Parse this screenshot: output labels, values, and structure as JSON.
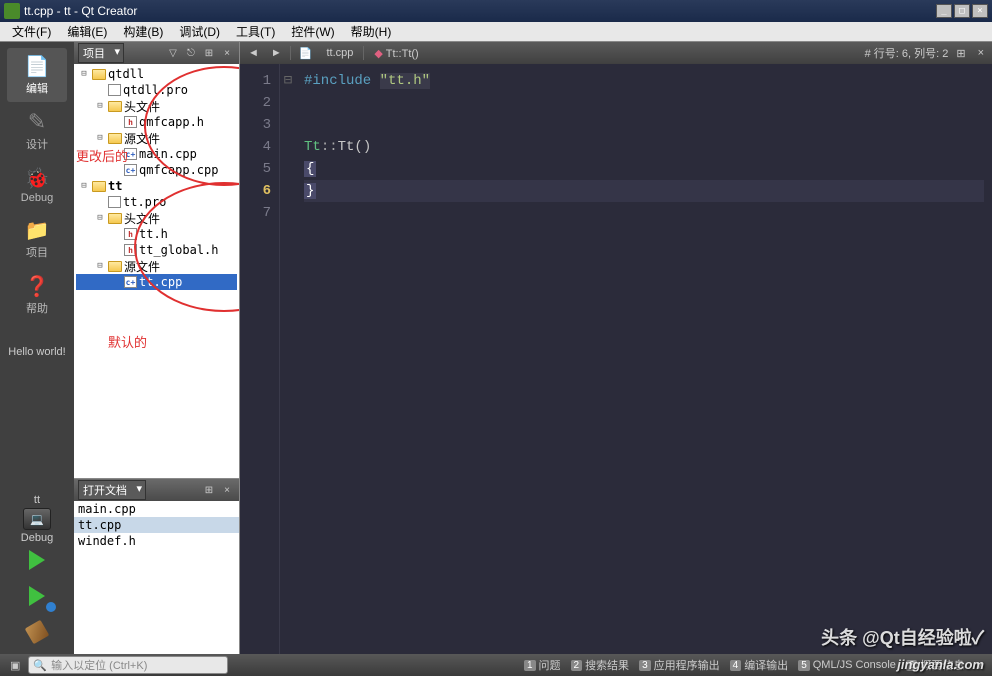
{
  "title": "tt.cpp - tt - Qt Creator",
  "menus": [
    "文件(F)",
    "编辑(E)",
    "构建(B)",
    "调试(D)",
    "工具(T)",
    "控件(W)",
    "帮助(H)"
  ],
  "mode_buttons": [
    {
      "icon": "edit",
      "label": "编辑",
      "sel": true
    },
    {
      "icon": "design",
      "label": "设计",
      "sel": false
    },
    {
      "icon": "debug",
      "label": "Debug",
      "sel": false
    },
    {
      "icon": "proj",
      "label": "项目",
      "sel": false
    },
    {
      "icon": "help",
      "label": "帮助",
      "sel": false
    }
  ],
  "hello": "Hello world!",
  "target_name": "tt",
  "target_config": "Debug",
  "project_panel": {
    "title": "项目"
  },
  "tree": [
    {
      "d": 0,
      "tw": "⊟",
      "ic": "folder",
      "t": "qtdll"
    },
    {
      "d": 1,
      "tw": "",
      "ic": "file-p",
      "t": "qtdll.pro"
    },
    {
      "d": 1,
      "tw": "⊟",
      "ic": "folder",
      "t": "头文件"
    },
    {
      "d": 2,
      "tw": "",
      "ic": "file-h",
      "t": "qmfcapp.h"
    },
    {
      "d": 1,
      "tw": "⊟",
      "ic": "folder",
      "t": "源文件"
    },
    {
      "d": 2,
      "tw": "",
      "ic": "file-c",
      "t": "main.cpp"
    },
    {
      "d": 2,
      "tw": "",
      "ic": "file-c",
      "t": "qmfcapp.cpp"
    },
    {
      "d": 0,
      "tw": "⊟",
      "ic": "folder",
      "t": "tt",
      "bold": true
    },
    {
      "d": 1,
      "tw": "",
      "ic": "file-p",
      "t": "tt.pro"
    },
    {
      "d": 1,
      "tw": "⊟",
      "ic": "folder",
      "t": "头文件"
    },
    {
      "d": 2,
      "tw": "",
      "ic": "file-h",
      "t": "tt.h"
    },
    {
      "d": 2,
      "tw": "",
      "ic": "file-h",
      "t": "tt_global.h"
    },
    {
      "d": 1,
      "tw": "⊟",
      "ic": "folder",
      "t": "源文件"
    },
    {
      "d": 2,
      "tw": "",
      "ic": "file-c",
      "t": "tt.cpp",
      "sel": true
    }
  ],
  "annotations": {
    "changed": "更改后的",
    "default": "默认的"
  },
  "open_docs": {
    "title": "打开文档",
    "items": [
      "main.cpp",
      "tt.cpp",
      "windef.h"
    ],
    "sel": 1
  },
  "editor_crumbs": {
    "file": "tt.cpp",
    "symbol": "Tt::Tt()"
  },
  "editor_status": "# 行号: 6, 列号: 2",
  "code_lines": [
    {
      "n": 1,
      "html": "<span class='pp'>#include</span> <span class='str'>\"tt.h\"</span>"
    },
    {
      "n": 2,
      "html": ""
    },
    {
      "n": 3,
      "html": ""
    },
    {
      "n": 4,
      "html": "<span class='cls'>Tt</span><span class='op'>::</span>Tt()",
      "fold": "⊟"
    },
    {
      "n": 5,
      "html": "<span class='brace'>{</span>"
    },
    {
      "n": 6,
      "html": "<span class='brace'>}</span>",
      "cur": true
    },
    {
      "n": 7,
      "html": ""
    }
  ],
  "locator_placeholder": "输入以定位 (Ctrl+K)",
  "output_tabs": [
    {
      "n": "1",
      "t": "问题"
    },
    {
      "n": "2",
      "t": "搜索结果"
    },
    {
      "n": "3",
      "t": "应用程序输出"
    },
    {
      "n": "4",
      "t": "编译输出"
    },
    {
      "n": "5",
      "t": "QML/JS Console"
    },
    {
      "n": "6",
      "t": "概要信息"
    }
  ],
  "watermark1": "头条 @Qt自经验啦✓",
  "watermark2": "jingyanla.com"
}
